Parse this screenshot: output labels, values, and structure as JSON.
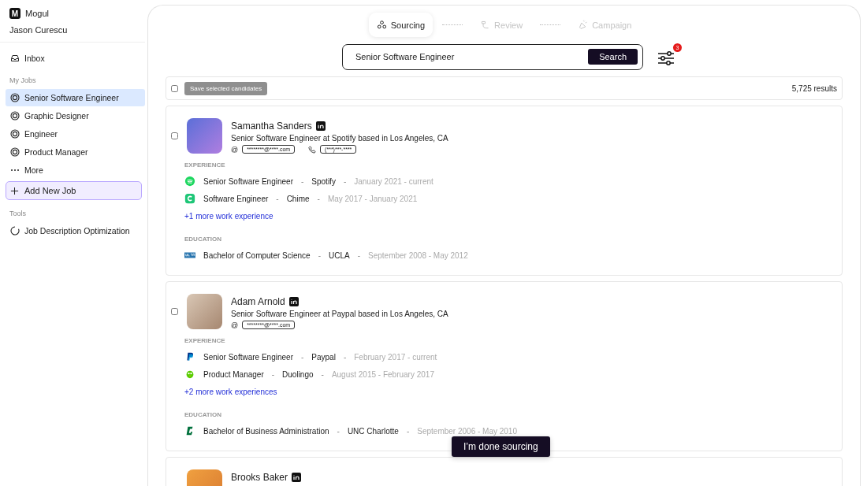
{
  "app": {
    "logo": "M",
    "name": "Mogul"
  },
  "user": "Jason Curescu",
  "inbox": {
    "label": "Inbox"
  },
  "my_jobs": {
    "heading": "My Jobs",
    "items": [
      {
        "label": "Senior Software Engineer",
        "selected": true
      },
      {
        "label": "Graphic Designer",
        "selected": false
      },
      {
        "label": "Engineer",
        "selected": false
      },
      {
        "label": "Product Manager",
        "selected": false
      }
    ],
    "more": "More",
    "add_button": "Add New Job"
  },
  "tools": {
    "heading": "Tools",
    "items": [
      {
        "label": "Job Description Optimization"
      }
    ]
  },
  "steps": [
    {
      "label": "Sourcing",
      "selected": true,
      "kind": "sourcing"
    },
    {
      "label": "Review",
      "selected": false,
      "kind": "review"
    },
    {
      "label": "Campaign",
      "selected": false,
      "kind": "campaign"
    }
  ],
  "search": {
    "value": "Senior Software Engineer",
    "button": "Search"
  },
  "filters": {
    "badge": "3"
  },
  "toolbar": {
    "checked": false,
    "save_button": {
      "label": "Save selected candidates",
      "disabled": true
    },
    "results": "5,725 results"
  },
  "candidates": [
    {
      "name": "Samantha Sanders",
      "checked": false,
      "headline": "Senior Software Engineer at Spotify based in Los Angeles, CA",
      "email": "********@****.com",
      "phone": "(***)***-****",
      "email_label": "@",
      "experience_heading": "EXPERIENCE",
      "experience": [
        {
          "title": "Senior Software Engineer",
          "org": "Spotify",
          "dates": "January 2021 - current",
          "kind": "spotify"
        },
        {
          "title": "Software Engineer",
          "org": "Chime",
          "dates": "May 2017 - January 2021",
          "kind": "chime"
        }
      ],
      "more_link": "+1 more work experience",
      "education_heading": "EDUCATION",
      "education": [
        {
          "title": "Bachelor of Computer Science",
          "org": "UCLA",
          "dates": "September 2008 - May 2012",
          "kind": "ucla"
        }
      ]
    },
    {
      "name": "Adam Arnold",
      "checked": false,
      "headline": "Senior Software Engineer at Paypal based in Los Angeles, CA",
      "email": "********@****.com",
      "email_label": "@",
      "experience_heading": "EXPERIENCE",
      "experience": [
        {
          "title": "Senior Software Engineer",
          "org": "Paypal",
          "dates": "February 2017 - current",
          "kind": "paypal"
        },
        {
          "title": "Product Manager",
          "org": "Duolingo",
          "dates": "August 2015 - February 2017",
          "kind": "duolingo"
        }
      ],
      "more_link": "+2 more work experiences",
      "education_heading": "EDUCATION",
      "education": [
        {
          "title": "Bachelor of Business Administration",
          "org": "UNC Charlotte",
          "dates": "September 2006 - May 2010",
          "kind": "unc"
        }
      ]
    },
    {
      "name": "Brooks Baker"
    }
  ],
  "entry_separator": "-",
  "done_button": "I’m done sourcing"
}
